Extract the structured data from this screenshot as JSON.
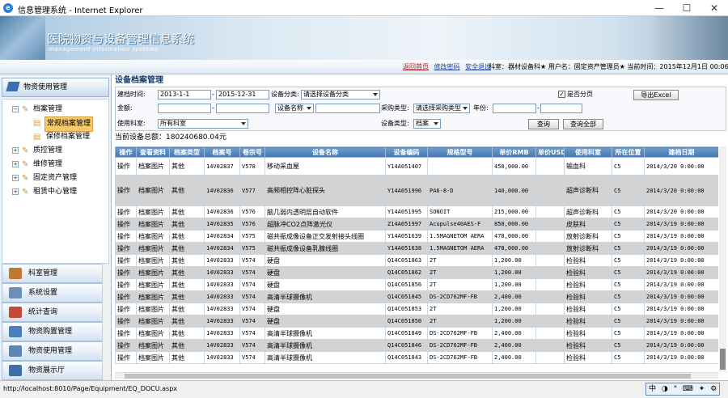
{
  "window": {
    "title": "信息管理系统 - Internet Explorer",
    "minimize": "—",
    "maximize": "☐",
    "close": "✕"
  },
  "banner": {
    "title": "医院物资与设备管理信息系统",
    "subtitle": "management information systems"
  },
  "infobar": {
    "links": [
      "返回首页",
      "修改密码",
      "安全退出"
    ],
    "user_info": "科室：器材设备科★ 用户名：固定资产管理员★ 当前时间：2015年12月1日 00:06:21"
  },
  "sidebar": {
    "top_header": "物资使用管理",
    "tree": [
      {
        "label": "档案管理",
        "level": 0,
        "toggle": "−",
        "selected": false
      },
      {
        "label": "常规档案管理",
        "level": 1,
        "toggle": "",
        "selected": true
      },
      {
        "label": "保修档案管理",
        "level": 1,
        "toggle": "",
        "selected": false
      },
      {
        "label": "质控管理",
        "level": 0,
        "toggle": "+",
        "selected": false
      },
      {
        "label": "维修管理",
        "level": 0,
        "toggle": "+",
        "selected": false
      },
      {
        "label": "固定资产管理",
        "level": 0,
        "toggle": "+",
        "selected": false
      },
      {
        "label": "租赁中心管理",
        "level": 0,
        "toggle": "+",
        "selected": false
      }
    ],
    "nav": [
      {
        "label": "科室管理",
        "color": "#c0792e"
      },
      {
        "label": "系统设置",
        "color": "#6d8fb3"
      },
      {
        "label": "统计查询",
        "color": "#c24a3a"
      },
      {
        "label": "物资购置管理",
        "color": "#4a7fb8"
      },
      {
        "label": "物资使用管理",
        "color": "#5a86b0"
      },
      {
        "label": "物资展示厅",
        "color": "#3d6fa6"
      }
    ]
  },
  "main": {
    "page_title": "设备档案管理",
    "filter": {
      "build_time_label": "建档时间:",
      "date_from": "2013-1-1",
      "date_to": "2015-12-31",
      "category_label": "设备分类:",
      "category_value": "请选择设备分类",
      "paging_label": "是否分页",
      "paging_checked": "✓",
      "export_button": "导出Excel",
      "amount_label": "金额:",
      "name_select": "设备名称",
      "purchase_label": "采购类型:",
      "purchase_value": "请选择采购类型",
      "year_label": "年份:",
      "dept_label": "使用科室:",
      "dept_value": "所有科室",
      "type_label": "设备类型:",
      "type_value": "档案",
      "query_button": "查询",
      "query_all_button": "查询全部"
    },
    "total_text": "当前设备总额：180240680.04元",
    "columns": [
      "操作",
      "查看资料",
      "档案类型",
      "档案号",
      "卷宗号",
      "设备名称",
      "设备编码",
      "规格型号",
      "单价RMB",
      "单价USD",
      "使用科室",
      "所在位置",
      "建档日期"
    ],
    "rows": [
      {
        "h": 22,
        "alt": false,
        "cells": [
          "操作",
          "档案图片",
          "其他",
          "14V02837",
          "V578",
          "移动采血屋",
          "Y14A051407",
          "",
          "450,000.00",
          "",
          "输血科",
          "C5",
          "2014/3/20 0:00:00"
        ]
      },
      {
        "h": 38,
        "alt": true,
        "cells": [
          "操作",
          "档案图片",
          "其他",
          "14V02836",
          "V577",
          "高频相控阵心脏探头",
          "Y14A051996",
          "PA6-8-D",
          "140,000.00",
          "",
          "超声诊断科",
          "C5",
          "2014/3/20 0:00:00"
        ]
      },
      {
        "h": 15,
        "alt": false,
        "cells": [
          "操作",
          "档案图片",
          "其他",
          "14V02836",
          "V576",
          "脑几弱内透明层自动软件",
          "Y14A051995",
          "SONOIT",
          "215,000.00",
          "",
          "超声诊断科",
          "C5",
          "2014/3/20 0:00:00"
        ]
      },
      {
        "h": 15,
        "alt": true,
        "cells": [
          "操作",
          "档案图片",
          "其他",
          "14V02835",
          "V576",
          "超脉冲CO2点阵激光仪",
          "Z14A051997",
          "Acupulse40AES-F",
          "850,000.00",
          "",
          "皮肤科",
          "C5",
          "2014/3/19 0:00:00"
        ]
      },
      {
        "h": 15,
        "alt": false,
        "cells": [
          "操作",
          "档案图片",
          "其他",
          "14V02834",
          "V575",
          "磁共振成像设备正交发射接头线圈",
          "Y14A051639",
          "1.5MAGNETOM AERA",
          "478,000.00",
          "",
          "放射诊断科",
          "C5",
          "2014/3/19 0:00:00"
        ]
      },
      {
        "h": 15,
        "alt": true,
        "cells": [
          "操作",
          "档案图片",
          "其他",
          "14V02834",
          "V575",
          "磁共振成像设备乳腺线圈",
          "Y14A051638",
          "1.5MAGNETOM AERA",
          "478,000.00",
          "",
          "放射诊断科",
          "C5",
          "2014/3/19 0:00:00"
        ]
      },
      {
        "h": 15,
        "alt": false,
        "cells": [
          "操作",
          "档案图片",
          "其他",
          "14V02833",
          "V574",
          "硬盘",
          "Q14C051863",
          "2T",
          "1,200.00",
          "",
          "检验科",
          "C5",
          "2014/3/19 0:00:00"
        ]
      },
      {
        "h": 15,
        "alt": true,
        "cells": [
          "操作",
          "档案图片",
          "其他",
          "14V02833",
          "V574",
          "硬盘",
          "Q14C051862",
          "2T",
          "1,200.00",
          "",
          "检验科",
          "C5",
          "2014/3/19 0:00:00"
        ]
      },
      {
        "h": 15,
        "alt": false,
        "cells": [
          "操作",
          "档案图片",
          "其他",
          "14V02833",
          "V574",
          "硬盘",
          "Q14C051856",
          "2T",
          "1,200.00",
          "",
          "检验科",
          "C5",
          "2014/3/19 0:00:00"
        ]
      },
      {
        "h": 15,
        "alt": true,
        "cells": [
          "操作",
          "档案图片",
          "其他",
          "14V02833",
          "V574",
          "高清半球摄像机",
          "Q14C051845",
          "DS-2CD762MF-FB",
          "2,400.00",
          "",
          "检验科",
          "C5",
          "2014/3/19 0:00:00"
        ]
      },
      {
        "h": 15,
        "alt": false,
        "cells": [
          "操作",
          "档案图片",
          "其他",
          "14V02833",
          "V574",
          "硬盘",
          "Q14C051853",
          "2T",
          "1,200.00",
          "",
          "检验科",
          "C5",
          "2014/3/19 0:00:00"
        ]
      },
      {
        "h": 15,
        "alt": true,
        "cells": [
          "操作",
          "档案图片",
          "其他",
          "14V02833",
          "V574",
          "硬盘",
          "Q14C051850",
          "2T",
          "1,200.00",
          "",
          "检验科",
          "C5",
          "2014/3/19 0:00:00"
        ]
      },
      {
        "h": 15,
        "alt": false,
        "cells": [
          "操作",
          "档案图片",
          "其他",
          "14V02833",
          "V574",
          "高清半球摄像机",
          "Q14C051849",
          "DS-2CD762MF-FB",
          "2,400.00",
          "",
          "检验科",
          "C5",
          "2014/3/19 0:00:00"
        ]
      },
      {
        "h": 15,
        "alt": true,
        "cells": [
          "操作",
          "档案图片",
          "其他",
          "14V02833",
          "V574",
          "高清半球摄像机",
          "Q14C051846",
          "DS-2CD762MF-FB",
          "2,400.00",
          "",
          "检验科",
          "C5",
          "2014/3/19 0:00:00"
        ]
      },
      {
        "h": 15,
        "alt": false,
        "cells": [
          "操作",
          "档案图片",
          "其他",
          "14V02833",
          "V574",
          "高清半球摄像机",
          "Q14C051843",
          "DS-2CD762MF-FB",
          "2,400.00",
          "",
          "检验科",
          "C5",
          "2014/3/19 0:00:00"
        ]
      }
    ]
  },
  "statusbar": {
    "url": "http://localhost:8010/Page/Equipment/EQ_DOCU.aspx",
    "ime": "中 ◑ ° ⌨ ✦ ⚙"
  }
}
